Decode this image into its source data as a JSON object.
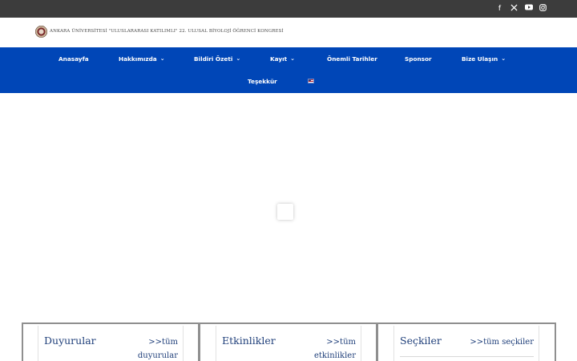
{
  "social": [
    {
      "name": "facebook",
      "glyph": "f"
    },
    {
      "name": "x",
      "glyph": "𝕏"
    },
    {
      "name": "youtube",
      "glyph": "▶"
    },
    {
      "name": "instagram",
      "glyph": "◎"
    }
  ],
  "brand": {
    "text": "ANKARA ÜNİVERSİTESİ \"ULUSLARARASI KATILIMLI\" 22. ULUSAL BİYOLOJİ ÖĞRENCİ KONGRESİ"
  },
  "nav": {
    "items": [
      {
        "label": "Anasayfa",
        "has_dropdown": false
      },
      {
        "label": "Hakkımızda",
        "has_dropdown": true
      },
      {
        "label": "Bildiri Özeti",
        "has_dropdown": true
      },
      {
        "label": "Kayıt",
        "has_dropdown": true
      },
      {
        "label": "Önemli Tarihler",
        "has_dropdown": false
      },
      {
        "label": "Sponsor",
        "has_dropdown": false
      },
      {
        "label": "Bize Ulaşın",
        "has_dropdown": true
      },
      {
        "label": "Teşekkür",
        "has_dropdown": false
      }
    ],
    "chevron": "⌄",
    "language_flag": "en-flag"
  },
  "cards": [
    {
      "title": "Duyurular",
      "link_line1": ">>tüm",
      "link_line2": "duyurular"
    },
    {
      "title": "Etkinlikler",
      "link_line1": ">>tüm",
      "link_line2": "etkinlikler"
    },
    {
      "title": "Seçkiler",
      "link_line1": ">>tüm seçkiler",
      "link_line2": ""
    }
  ],
  "colors": {
    "topbar": "#3c3c3c",
    "nav": "#0046b7",
    "card_text": "#1f3f7a"
  }
}
